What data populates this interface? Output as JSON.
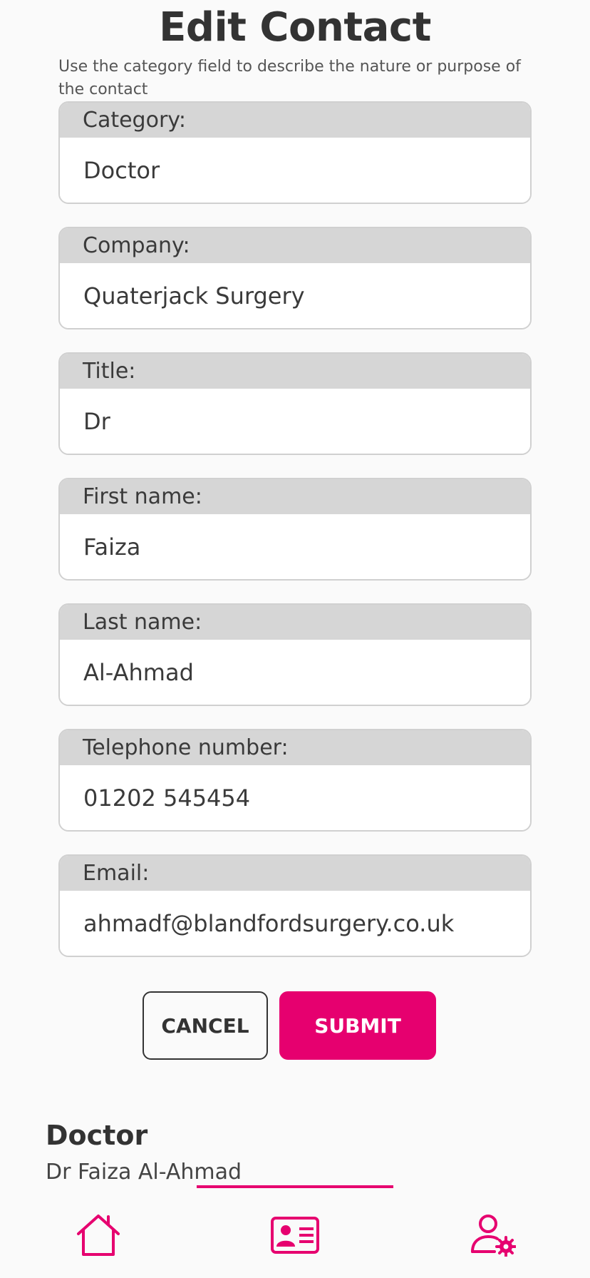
{
  "header": {
    "title": "Edit Contact",
    "hint": "Use the category field to describe the nature or purpose of the contact"
  },
  "form": {
    "fields": [
      {
        "label": "Category:",
        "value": "Doctor"
      },
      {
        "label": "Company:",
        "value": "Quaterjack Surgery"
      },
      {
        "label": "Title:",
        "value": "Dr"
      },
      {
        "label": "First name:",
        "value": "Faiza"
      },
      {
        "label": "Last name:",
        "value": "Al-Ahmad"
      },
      {
        "label": "Telephone number:",
        "value": "01202 545454"
      },
      {
        "label": "Email:",
        "value": "ahmadf@blandfordsurgery.co.uk"
      }
    ],
    "cancel_label": "CANCEL",
    "submit_label": "SUBMIT"
  },
  "summary": {
    "category": "Doctor",
    "name": "Dr Faiza Al-Ahmad"
  },
  "nav": {
    "items": [
      {
        "icon": "home-icon",
        "active": false
      },
      {
        "icon": "contact-card-icon",
        "active": true
      },
      {
        "icon": "user-settings-icon",
        "active": false
      }
    ]
  },
  "colors": {
    "accent": "#e6006f",
    "text": "#333333",
    "label_bg": "#d6d6d6",
    "background": "#fafafa"
  }
}
